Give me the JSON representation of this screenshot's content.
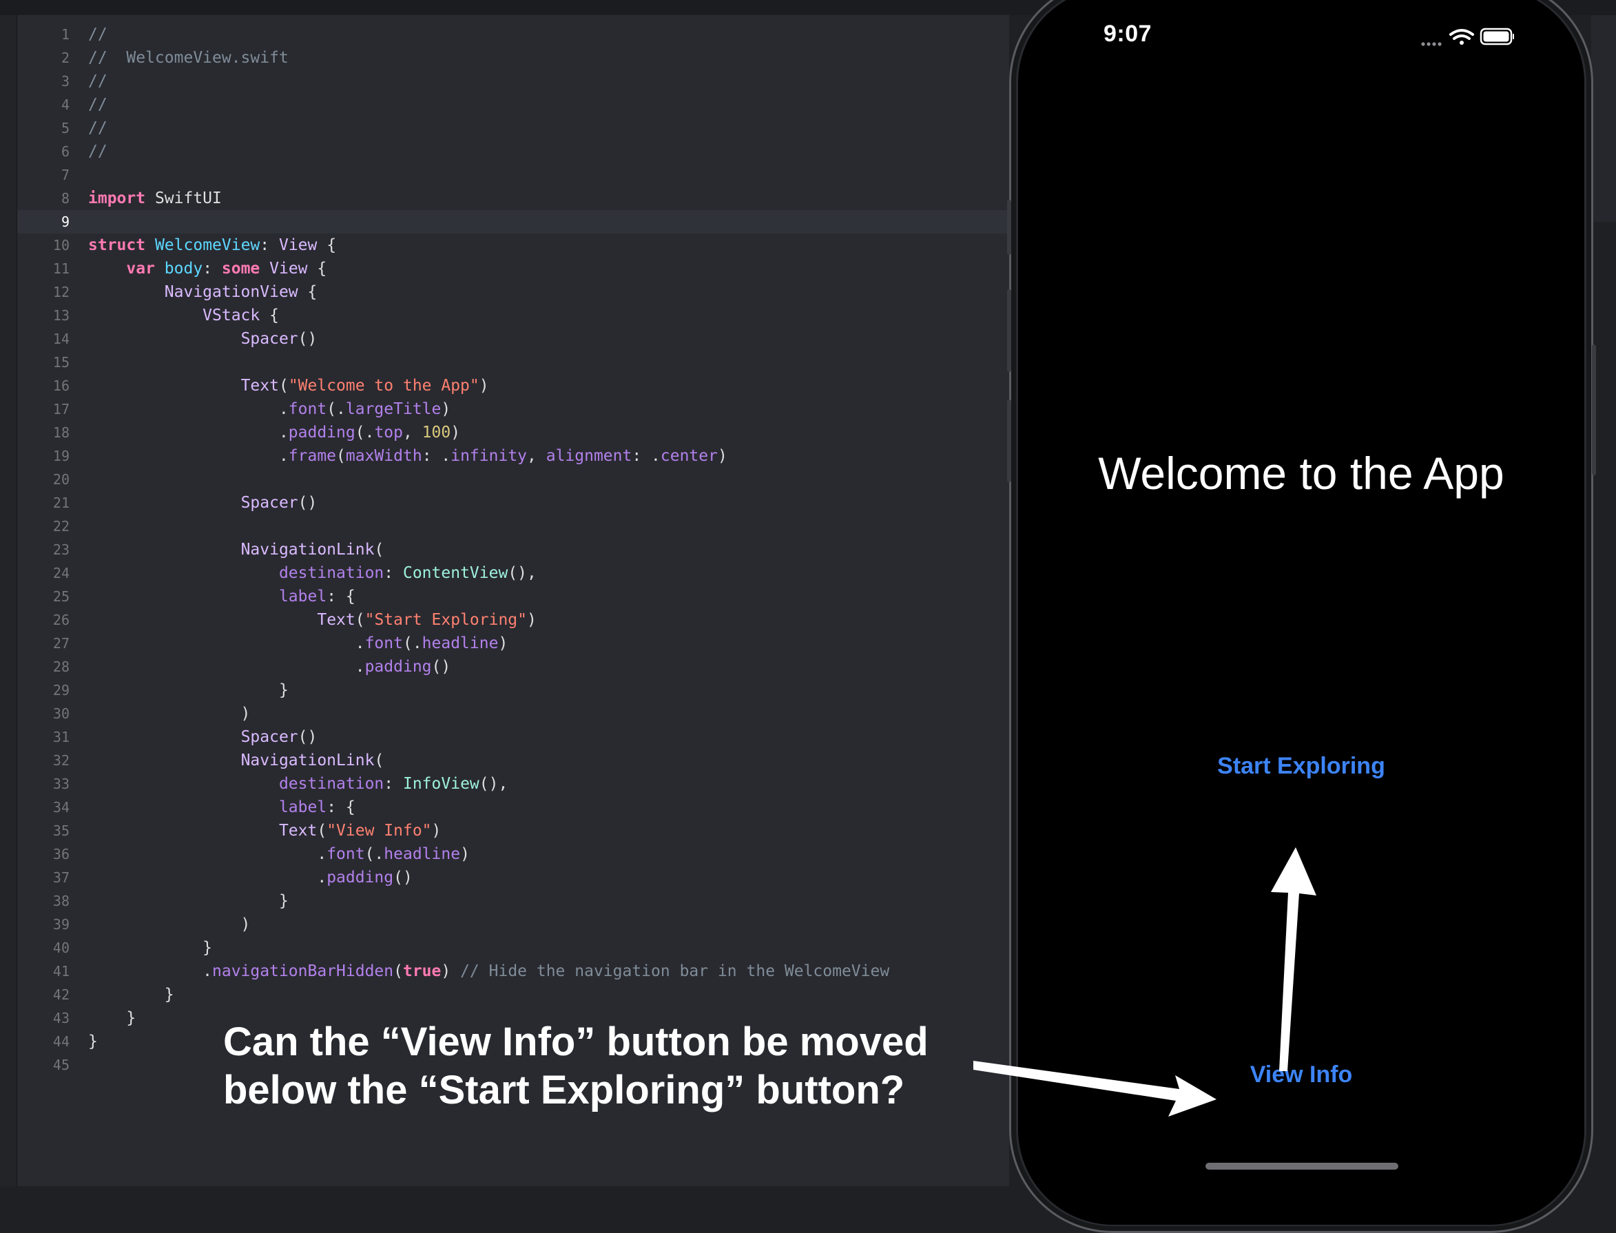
{
  "editor": {
    "current_line": 9,
    "lines": [
      {
        "n": "1",
        "tokens": [
          {
            "t": "//",
            "c": "cm"
          }
        ]
      },
      {
        "n": "2",
        "tokens": [
          {
            "t": "//  WelcomeView.swift",
            "c": "cm"
          }
        ]
      },
      {
        "n": "3",
        "tokens": [
          {
            "t": "//",
            "c": "cm"
          }
        ]
      },
      {
        "n": "4",
        "tokens": [
          {
            "t": "//",
            "c": "cm"
          }
        ]
      },
      {
        "n": "5",
        "tokens": [
          {
            "t": "//",
            "c": "cm"
          }
        ]
      },
      {
        "n": "6",
        "tokens": [
          {
            "t": "//",
            "c": "cm"
          }
        ]
      },
      {
        "n": "7",
        "tokens": []
      },
      {
        "n": "8",
        "tokens": [
          {
            "t": "import",
            "c": "kw"
          },
          {
            "t": " SwiftUI",
            "c": "pl"
          }
        ]
      },
      {
        "n": "9",
        "tokens": []
      },
      {
        "n": "10",
        "tokens": [
          {
            "t": "struct",
            "c": "kw"
          },
          {
            "t": " ",
            "c": "pl"
          },
          {
            "t": "WelcomeView",
            "c": "dec"
          },
          {
            "t": ": ",
            "c": "pl"
          },
          {
            "t": "View",
            "c": "typ"
          },
          {
            "t": " {",
            "c": "pl"
          }
        ]
      },
      {
        "n": "11",
        "tokens": [
          {
            "t": "    ",
            "c": "pl"
          },
          {
            "t": "var",
            "c": "kw"
          },
          {
            "t": " ",
            "c": "pl"
          },
          {
            "t": "body",
            "c": "dec"
          },
          {
            "t": ": ",
            "c": "pl"
          },
          {
            "t": "some",
            "c": "kw"
          },
          {
            "t": " ",
            "c": "pl"
          },
          {
            "t": "View",
            "c": "typ"
          },
          {
            "t": " {",
            "c": "pl"
          }
        ]
      },
      {
        "n": "12",
        "tokens": [
          {
            "t": "        ",
            "c": "pl"
          },
          {
            "t": "NavigationView",
            "c": "typ"
          },
          {
            "t": " {",
            "c": "pl"
          }
        ]
      },
      {
        "n": "13",
        "tokens": [
          {
            "t": "            ",
            "c": "pl"
          },
          {
            "t": "VStack",
            "c": "typ"
          },
          {
            "t": " {",
            "c": "pl"
          }
        ]
      },
      {
        "n": "14",
        "tokens": [
          {
            "t": "                ",
            "c": "pl"
          },
          {
            "t": "Spacer",
            "c": "typ"
          },
          {
            "t": "()",
            "c": "pl"
          }
        ]
      },
      {
        "n": "15",
        "tokens": []
      },
      {
        "n": "16",
        "tokens": [
          {
            "t": "                ",
            "c": "pl"
          },
          {
            "t": "Text",
            "c": "typ"
          },
          {
            "t": "(",
            "c": "pl"
          },
          {
            "t": "\"Welcome to the App\"",
            "c": "str"
          },
          {
            "t": ")",
            "c": "pl"
          }
        ]
      },
      {
        "n": "17",
        "tokens": [
          {
            "t": "                    .",
            "c": "pl"
          },
          {
            "t": "font",
            "c": "fn"
          },
          {
            "t": "(.",
            "c": "pl"
          },
          {
            "t": "largeTitle",
            "c": "fn"
          },
          {
            "t": ")",
            "c": "pl"
          }
        ]
      },
      {
        "n": "18",
        "tokens": [
          {
            "t": "                    .",
            "c": "pl"
          },
          {
            "t": "padding",
            "c": "fn"
          },
          {
            "t": "(.",
            "c": "pl"
          },
          {
            "t": "top",
            "c": "fn"
          },
          {
            "t": ", ",
            "c": "pl"
          },
          {
            "t": "100",
            "c": "num"
          },
          {
            "t": ")",
            "c": "pl"
          }
        ]
      },
      {
        "n": "19",
        "tokens": [
          {
            "t": "                    .",
            "c": "pl"
          },
          {
            "t": "frame",
            "c": "fn"
          },
          {
            "t": "(",
            "c": "pl"
          },
          {
            "t": "maxWidth",
            "c": "fn"
          },
          {
            "t": ": .",
            "c": "pl"
          },
          {
            "t": "infinity",
            "c": "fn"
          },
          {
            "t": ", ",
            "c": "pl"
          },
          {
            "t": "alignment",
            "c": "fn"
          },
          {
            "t": ": .",
            "c": "pl"
          },
          {
            "t": "center",
            "c": "fn"
          },
          {
            "t": ")",
            "c": "pl"
          }
        ]
      },
      {
        "n": "20",
        "tokens": []
      },
      {
        "n": "21",
        "tokens": [
          {
            "t": "                ",
            "c": "pl"
          },
          {
            "t": "Spacer",
            "c": "typ"
          },
          {
            "t": "()",
            "c": "pl"
          }
        ]
      },
      {
        "n": "22",
        "tokens": []
      },
      {
        "n": "23",
        "tokens": [
          {
            "t": "                ",
            "c": "pl"
          },
          {
            "t": "NavigationLink",
            "c": "typ"
          },
          {
            "t": "(",
            "c": "pl"
          }
        ]
      },
      {
        "n": "24",
        "tokens": [
          {
            "t": "                    ",
            "c": "pl"
          },
          {
            "t": "destination",
            "c": "fn"
          },
          {
            "t": ": ",
            "c": "pl"
          },
          {
            "t": "ContentView",
            "c": "cls"
          },
          {
            "t": "(),",
            "c": "pl"
          }
        ]
      },
      {
        "n": "25",
        "tokens": [
          {
            "t": "                    ",
            "c": "pl"
          },
          {
            "t": "label",
            "c": "fn"
          },
          {
            "t": ": {",
            "c": "pl"
          }
        ]
      },
      {
        "n": "26",
        "tokens": [
          {
            "t": "                        ",
            "c": "pl"
          },
          {
            "t": "Text",
            "c": "typ"
          },
          {
            "t": "(",
            "c": "pl"
          },
          {
            "t": "\"Start Exploring\"",
            "c": "str"
          },
          {
            "t": ")",
            "c": "pl"
          }
        ]
      },
      {
        "n": "27",
        "tokens": [
          {
            "t": "                            .",
            "c": "pl"
          },
          {
            "t": "font",
            "c": "fn"
          },
          {
            "t": "(.",
            "c": "pl"
          },
          {
            "t": "headline",
            "c": "fn"
          },
          {
            "t": ")",
            "c": "pl"
          }
        ]
      },
      {
        "n": "28",
        "tokens": [
          {
            "t": "                            .",
            "c": "pl"
          },
          {
            "t": "padding",
            "c": "fn"
          },
          {
            "t": "()",
            "c": "pl"
          }
        ]
      },
      {
        "n": "29",
        "tokens": [
          {
            "t": "                    }",
            "c": "pl"
          }
        ]
      },
      {
        "n": "30",
        "tokens": [
          {
            "t": "                )",
            "c": "pl"
          }
        ]
      },
      {
        "n": "31",
        "tokens": [
          {
            "t": "                ",
            "c": "pl"
          },
          {
            "t": "Spacer",
            "c": "typ"
          },
          {
            "t": "()",
            "c": "pl"
          }
        ]
      },
      {
        "n": "32",
        "tokens": [
          {
            "t": "                ",
            "c": "pl"
          },
          {
            "t": "NavigationLink",
            "c": "typ"
          },
          {
            "t": "(",
            "c": "pl"
          }
        ]
      },
      {
        "n": "33",
        "tokens": [
          {
            "t": "                    ",
            "c": "pl"
          },
          {
            "t": "destination",
            "c": "fn"
          },
          {
            "t": ": ",
            "c": "pl"
          },
          {
            "t": "InfoView",
            "c": "cls"
          },
          {
            "t": "(),",
            "c": "pl"
          }
        ]
      },
      {
        "n": "34",
        "tokens": [
          {
            "t": "                    ",
            "c": "pl"
          },
          {
            "t": "label",
            "c": "fn"
          },
          {
            "t": ": {",
            "c": "pl"
          }
        ]
      },
      {
        "n": "35",
        "tokens": [
          {
            "t": "                    ",
            "c": "pl"
          },
          {
            "t": "Text",
            "c": "typ"
          },
          {
            "t": "(",
            "c": "pl"
          },
          {
            "t": "\"View Info\"",
            "c": "str"
          },
          {
            "t": ")",
            "c": "pl"
          }
        ]
      },
      {
        "n": "36",
        "tokens": [
          {
            "t": "                        .",
            "c": "pl"
          },
          {
            "t": "font",
            "c": "fn"
          },
          {
            "t": "(.",
            "c": "pl"
          },
          {
            "t": "headline",
            "c": "fn"
          },
          {
            "t": ")",
            "c": "pl"
          }
        ]
      },
      {
        "n": "37",
        "tokens": [
          {
            "t": "                        .",
            "c": "pl"
          },
          {
            "t": "padding",
            "c": "fn"
          },
          {
            "t": "()",
            "c": "pl"
          }
        ]
      },
      {
        "n": "38",
        "tokens": [
          {
            "t": "                    }",
            "c": "pl"
          }
        ]
      },
      {
        "n": "39",
        "tokens": [
          {
            "t": "                )",
            "c": "pl"
          }
        ]
      },
      {
        "n": "40",
        "tokens": [
          {
            "t": "            }",
            "c": "pl"
          }
        ]
      },
      {
        "n": "41",
        "tokens": [
          {
            "t": "            .",
            "c": "pl"
          },
          {
            "t": "navigationBarHidden",
            "c": "fn"
          },
          {
            "t": "(",
            "c": "pl"
          },
          {
            "t": "true",
            "c": "kw"
          },
          {
            "t": ") ",
            "c": "pl"
          },
          {
            "t": "// Hide the navigation bar in the WelcomeView",
            "c": "cm"
          }
        ]
      },
      {
        "n": "42",
        "tokens": [
          {
            "t": "        }",
            "c": "pl"
          }
        ]
      },
      {
        "n": "43",
        "tokens": [
          {
            "t": "    }",
            "c": "pl"
          }
        ]
      },
      {
        "n": "44",
        "tokens": [
          {
            "t": "}",
            "c": "pl"
          }
        ]
      },
      {
        "n": "45",
        "tokens": []
      }
    ]
  },
  "annotation": {
    "line1": "Can the “View Info” button be moved",
    "line2": "below the “Start Exploring” button?",
    "arrow_color": "#ffffff"
  },
  "simulator": {
    "time": "9:07",
    "title": "Welcome to the App",
    "start_button": "Start Exploring",
    "info_button": "View Info",
    "link_color": "#3d84f7",
    "status_icons": [
      "signal-dots-icon",
      "wifi-icon",
      "battery-icon"
    ]
  }
}
